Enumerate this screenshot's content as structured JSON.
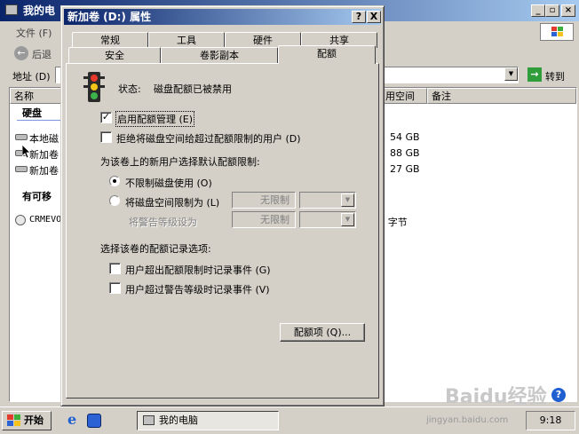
{
  "background_window": {
    "title": "我的电",
    "menu_file": "文件 (F)",
    "back_label": "后退",
    "address_label": "地址 (D)",
    "go_label": "转到",
    "col_name": "名称",
    "col_free": "用空间",
    "col_note": "备注",
    "section_hdd": "硬盘",
    "section_removable": "有可移",
    "drives": [
      {
        "name": "本地磁",
        "free": "54 GB"
      },
      {
        "name": "新加卷",
        "free": "88 GB"
      },
      {
        "name": "新加卷",
        "free": "27 GB"
      }
    ],
    "cd_item": "CRMEVO",
    "cd_size": ") 字节"
  },
  "dialog": {
    "title": "新加卷 (D:) 属性",
    "help_btn": "?",
    "close_btn": "X",
    "tabs_row1": [
      "常规",
      "工具",
      "硬件",
      "共享"
    ],
    "tabs_row2": [
      "安全",
      "卷影副本",
      "配额"
    ],
    "status_label": "状态:",
    "status_text": "磁盘配额已被禁用",
    "enable_quota": "启用配额管理 (E)",
    "deny_space": "拒绝将磁盘空间给超过配额限制的用户 (D)",
    "default_limit_header": "为该卷上的新用户选择默认配额限制:",
    "no_limit": "不限制磁盘使用 (O)",
    "limit_to": "将磁盘空间限制为 (L)",
    "limit_value": "无限制",
    "warn_level": "将警告等级设为",
    "warn_value": "无限制",
    "log_header": "选择该卷的配额记录选项:",
    "log_exceed_limit": "用户超出配额限制时记录事件 (G)",
    "log_exceed_warn": "用户超过警告等级时记录事件 (V)",
    "quota_entries_btn": "配额项 (Q)...",
    "enable_quota_checked": true,
    "deny_space_checked": false,
    "no_limit_selected": true,
    "log_exceed_limit_checked": false,
    "log_exceed_warn_checked": false
  },
  "taskbar": {
    "start_label": "开始",
    "task_label": "我的电脑",
    "clock": "9:18"
  },
  "watermark": {
    "brand": "Baidu经验",
    "url": "jingyan.baidu.com"
  },
  "colors": {
    "title_active": "#0a246a",
    "title_gradient_end": "#a6caf0",
    "face": "#d4d0c8",
    "desktop": "#3a6ea5"
  }
}
